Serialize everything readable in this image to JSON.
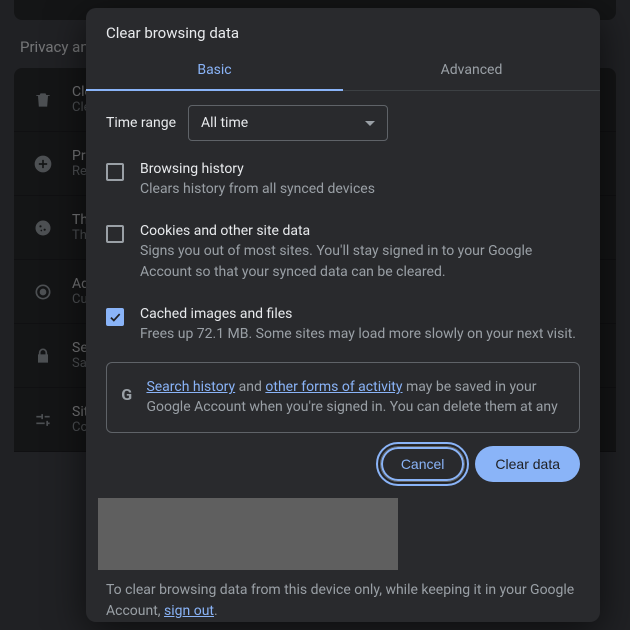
{
  "bg": {
    "section_title": "Privacy and security",
    "rows": [
      {
        "icon": "trash",
        "l1": "Clear browsing data",
        "l2": "Clear history, cookies, cache, and more"
      },
      {
        "icon": "plus",
        "l1": "Privacy Guide",
        "l2": "Review key privacy and security controls"
      },
      {
        "icon": "cookie",
        "l1": "Third-party cookies",
        "l2": "Third-party cookies are blocked in Incognito mode"
      },
      {
        "icon": "target",
        "l1": "Ads privacy",
        "l2": "Customize the info used by sites to show ads"
      },
      {
        "icon": "lock",
        "l1": "Security",
        "l2": "Safe Browsing (protection from dangerous sites) and other security settings"
      },
      {
        "icon": "sliders",
        "l1": "Site settings",
        "l2": "Controls what information sites can use and show"
      }
    ]
  },
  "dialog": {
    "title": "Clear browsing data",
    "tabs": {
      "basic": "Basic",
      "advanced": "Advanced"
    },
    "range_label": "Time range",
    "range_value": "All time",
    "options": [
      {
        "title": "Browsing history",
        "desc": "Clears history from all synced devices",
        "checked": false
      },
      {
        "title": "Cookies and other site data",
        "desc": "Signs you out of most sites. You'll stay signed in to your Google Account so that your synced data can be cleared.",
        "checked": false
      },
      {
        "title": "Cached images and files",
        "desc": "Frees up 72.1 MB. Some sites may load more slowly on your next visit.",
        "checked": true
      }
    ],
    "info": {
      "icon_letter": "G",
      "link1": "Search history",
      "mid1": " and ",
      "link2": "other forms of activity",
      "rest": " may be saved in your Google Account when you're signed in. You can delete them at any"
    },
    "buttons": {
      "cancel": "Cancel",
      "clear": "Clear data"
    },
    "footer": {
      "text": "To clear browsing data from this device only, while keeping it in your Google Account, ",
      "link": "sign out",
      "period": "."
    }
  }
}
